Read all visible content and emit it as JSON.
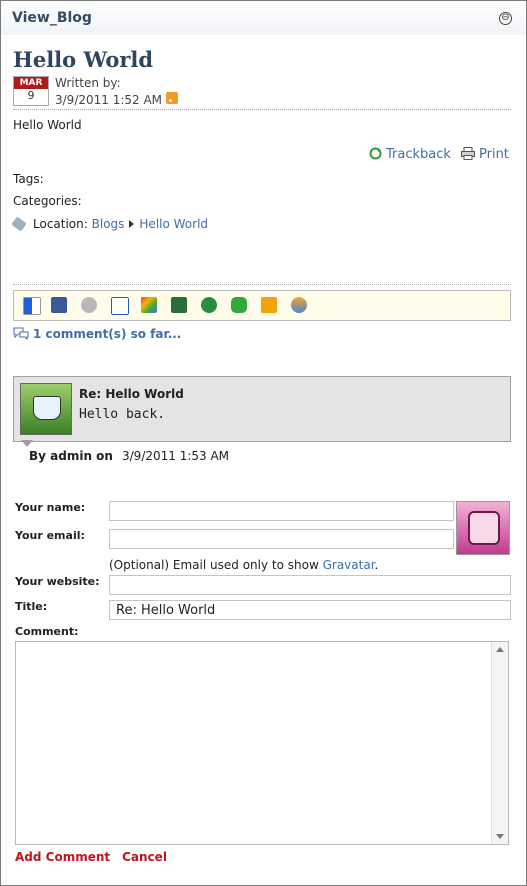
{
  "module": {
    "title": "View_Blog",
    "collapse_symbol": "⊖"
  },
  "post": {
    "title": "Hello World",
    "month": "MAR",
    "day": "9",
    "written_by": "Written by:",
    "date": "3/9/2011 1:52 AM",
    "body": "Hello World",
    "trackback": "Trackback",
    "print": "Print",
    "tags_label": "Tags:",
    "categories_label": "Categories:",
    "location_label": "Location:",
    "location_path": [
      "Blogs",
      "Hello World"
    ]
  },
  "share_icons": [
    "delicious-icon",
    "facebook-icon",
    "myspace-icon",
    "google-icon",
    "windows-live-icon",
    "reddit-icon",
    "stumbleupon-icon",
    "technorati-icon",
    "digg-icon",
    "friends-icon"
  ],
  "comments": {
    "count_text": "1 comment(s) so far...",
    "items": [
      {
        "title": "Re: Hello World",
        "body": "Hello back.",
        "by": "By admin on",
        "date": "3/9/2011 1:53 AM"
      }
    ]
  },
  "form": {
    "name_label": "Your name:",
    "email_label": "Your email:",
    "email_note_prefix": "(Optional) Email used only to show ",
    "gravatar_link": "Gravatar",
    "email_note_suffix": ".",
    "website_label": "Your website:",
    "title_label": "Title:",
    "title_value": "Re: Hello World",
    "comment_label": "Comment:",
    "add_button": "Add Comment",
    "cancel_button": "Cancel"
  },
  "colors": {
    "link": "#3f6fa8",
    "action": "#c0161d",
    "title": "#2c4560",
    "calendar": "#b11a1a"
  }
}
